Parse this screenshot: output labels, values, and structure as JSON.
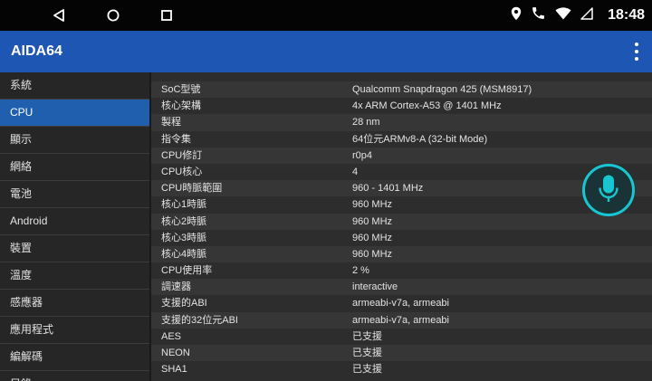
{
  "status": {
    "time": "18:48"
  },
  "appbar": {
    "title": "AIDA64"
  },
  "sidebar": {
    "items": [
      {
        "label": "系統"
      },
      {
        "label": "CPU",
        "active": true
      },
      {
        "label": "顯示"
      },
      {
        "label": "網絡"
      },
      {
        "label": "電池"
      },
      {
        "label": "Android"
      },
      {
        "label": "裝置"
      },
      {
        "label": "溫度"
      },
      {
        "label": "感應器"
      },
      {
        "label": "應用程式"
      },
      {
        "label": "編解碼"
      },
      {
        "label": "目錄"
      }
    ]
  },
  "cpu": {
    "rows": [
      {
        "label": "SoC型號",
        "value": "Qualcomm Snapdragon 425 (MSM8917)"
      },
      {
        "label": "核心架構",
        "value": "4x ARM Cortex-A53 @ 1401 MHz"
      },
      {
        "label": "製程",
        "value": "28 nm"
      },
      {
        "label": "指令集",
        "value": "64位元ARMv8-A (32-bit Mode)"
      },
      {
        "label": "CPU修訂",
        "value": "r0p4"
      },
      {
        "label": "CPU核心",
        "value": "4"
      },
      {
        "label": "CPU時脈範圍",
        "value": "960 - 1401 MHz"
      },
      {
        "label": "核心1時脈",
        "value": "960 MHz"
      },
      {
        "label": "核心2時脈",
        "value": "960 MHz"
      },
      {
        "label": "核心3時脈",
        "value": "960 MHz"
      },
      {
        "label": "核心4時脈",
        "value": "960 MHz"
      },
      {
        "label": "CPU使用率",
        "value": "2 %"
      },
      {
        "label": "調速器",
        "value": "interactive"
      },
      {
        "label": "支援的ABI",
        "value": "armeabi-v7a, armeabi"
      },
      {
        "label": "支援的32位元ABI",
        "value": "armeabi-v7a, armeabi"
      },
      {
        "label": "AES",
        "value": "已支援"
      },
      {
        "label": "NEON",
        "value": "已支援"
      },
      {
        "label": "SHA1",
        "value": "已支援"
      }
    ]
  },
  "colors": {
    "accent": "#1e56b3",
    "selected": "#1f5fae",
    "mic_ring": "#16c7d2"
  },
  "icons": [
    "back-icon",
    "home-icon",
    "recents-icon",
    "location-icon",
    "phone-icon",
    "wifi-icon",
    "signal-icon",
    "overflow-menu-icon",
    "microphone-icon"
  ]
}
